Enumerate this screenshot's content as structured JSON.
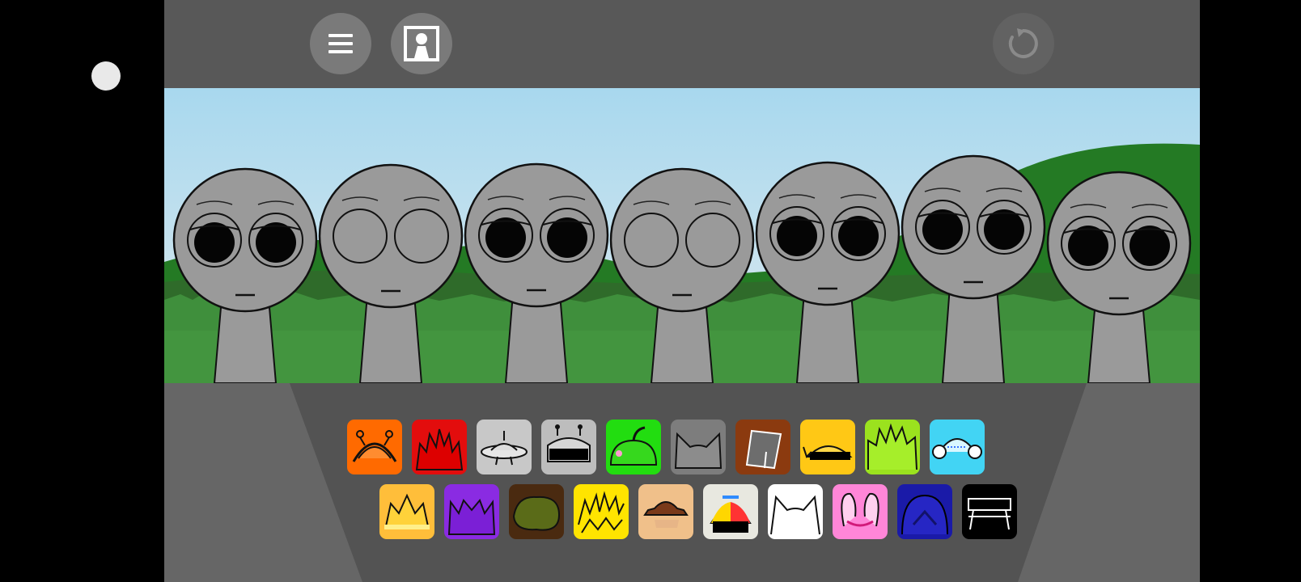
{
  "colors": {
    "background": "#000000",
    "game_panel": "#585858",
    "button": "#7a7a7a",
    "sky_top": "#a8d8ee",
    "grass": "#3f8f3c",
    "character": "#9a9a9a"
  },
  "toolbar": {
    "menu_icon": "hamburger-menu-icon",
    "profile_icon": "keyhole-portrait-icon",
    "restart_icon": "restart-icon"
  },
  "characters": [
    {
      "eyes": "dark"
    },
    {
      "eyes": "empty"
    },
    {
      "eyes": "dark"
    },
    {
      "eyes": "empty"
    },
    {
      "eyes": "dark"
    },
    {
      "eyes": "dark"
    },
    {
      "eyes": "dark"
    }
  ],
  "sound_icons": {
    "row1": [
      {
        "name": "orange-antenna-icon",
        "color": "#ff6a00"
      },
      {
        "name": "red-spiky-icon",
        "color": "#e30d0d"
      },
      {
        "name": "silver-ufo-icon",
        "color": "#c8c8c8"
      },
      {
        "name": "robot-visor-icon",
        "color": "#bdbdbd"
      },
      {
        "name": "green-fruit-icon",
        "color": "#22dd10"
      },
      {
        "name": "gray-cat-ears-icon",
        "color": "#7d7d7d"
      },
      {
        "name": "brown-bucket-icon",
        "color": "#8b3a0f"
      },
      {
        "name": "yellow-helmet-icon",
        "color": "#ffc815"
      },
      {
        "name": "lime-spiky-hair-icon",
        "color": "#9be21e"
      },
      {
        "name": "cyan-headphones-icon",
        "color": "#42d4f4"
      }
    ],
    "row2": [
      {
        "name": "orange-crown-icon",
        "color": "#ffbe3a"
      },
      {
        "name": "purple-horns-icon",
        "color": "#8a2be2"
      },
      {
        "name": "olive-bush-icon",
        "color": "#4a2a10"
      },
      {
        "name": "yellow-lightning-icon",
        "color": "#ffe400"
      },
      {
        "name": "brown-hat-icon",
        "color": "#f0c08a"
      },
      {
        "name": "propeller-cap-icon",
        "color": "#e8e8e0"
      },
      {
        "name": "white-cat-icon",
        "color": "#ffffff"
      },
      {
        "name": "pink-bunny-ears-icon",
        "color": "#ff86d8"
      },
      {
        "name": "navy-dome-icon",
        "color": "#1a1aa8"
      },
      {
        "name": "black-bench-icon",
        "color": "#000000"
      }
    ]
  }
}
